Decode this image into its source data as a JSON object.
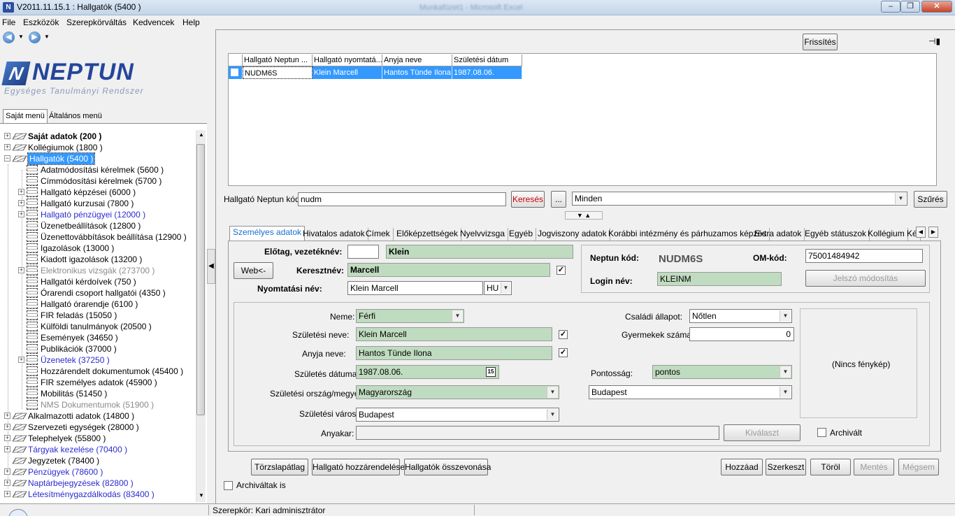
{
  "window": {
    "title": "V2011.11.15.1 : Hallgatók (5400  )",
    "background_title": "Munkafüzet1 - Microsoft Excel",
    "app_icon": "N",
    "minimize": "–",
    "restore": "❐",
    "close": "✕"
  },
  "menu": [
    "File",
    "Eszközök",
    "Szerepkörváltás",
    "Kedvencek",
    "Help"
  ],
  "nav": {
    "back": "◀",
    "forward": "▶",
    "drop": "▼"
  },
  "logo": {
    "mark": "N",
    "text": "NEPTUN",
    "subtitle": "Egységes Tanulmányi Rendszer"
  },
  "sidebar_tabs": {
    "own": "Saját menü",
    "general": "Általános menü"
  },
  "tree": [
    {
      "label": "Saját adatok (200  )",
      "level": 0,
      "expander": "+",
      "icon": "book",
      "style": "bold"
    },
    {
      "label": "Kollégiumok (1800  )",
      "level": 0,
      "expander": "+",
      "icon": "book",
      "style": ""
    },
    {
      "label": "Hallgatók (5400  )",
      "level": 0,
      "expander": "−",
      "icon": "book",
      "style": "sel"
    },
    {
      "label": "Adatmódosítási kérelmek (5600  )",
      "level": 1,
      "expander": "",
      "icon": "doc",
      "style": ""
    },
    {
      "label": "Címmódosítási kérelmek (5700  )",
      "level": 1,
      "expander": "",
      "icon": "doc",
      "style": ""
    },
    {
      "label": "Hallgató képzései (6000  )",
      "level": 1,
      "expander": "+",
      "icon": "doc",
      "style": ""
    },
    {
      "label": "Hallgató kurzusai (7800  )",
      "level": 1,
      "expander": "+",
      "icon": "doc",
      "style": ""
    },
    {
      "label": "Hallgató pénzügyei (12000  )",
      "level": 1,
      "expander": "+",
      "icon": "doc",
      "style": "blue"
    },
    {
      "label": "Üzenetbeállítások (12800  )",
      "level": 1,
      "expander": "",
      "icon": "doc",
      "style": ""
    },
    {
      "label": "Üzenettovábbítások beállítása (12900  )",
      "level": 1,
      "expander": "",
      "icon": "doc",
      "style": ""
    },
    {
      "label": "Igazolások (13000  )",
      "level": 1,
      "expander": "",
      "icon": "doc",
      "style": ""
    },
    {
      "label": "Kiadott igazolások (13200  )",
      "level": 1,
      "expander": "",
      "icon": "doc",
      "style": ""
    },
    {
      "label": "Elektronikus vizsgák (273700  )",
      "level": 1,
      "expander": "+",
      "icon": "doc",
      "style": "gray"
    },
    {
      "label": "Hallgatói kérdoívek (750  )",
      "level": 1,
      "expander": "",
      "icon": "doc",
      "style": ""
    },
    {
      "label": "Órarendi csoport hallgatói (4350  )",
      "level": 1,
      "expander": "",
      "icon": "doc",
      "style": ""
    },
    {
      "label": "Hallgató órarendje (6100  )",
      "level": 1,
      "expander": "",
      "icon": "doc",
      "style": ""
    },
    {
      "label": "FIR feladás (15050  )",
      "level": 1,
      "expander": "",
      "icon": "doc",
      "style": ""
    },
    {
      "label": "Külföldi tanulmányok (20500  )",
      "level": 1,
      "expander": "",
      "icon": "doc",
      "style": ""
    },
    {
      "label": "Események (34650  )",
      "level": 1,
      "expander": "",
      "icon": "doc",
      "style": ""
    },
    {
      "label": "Publikációk (37000  )",
      "level": 1,
      "expander": "",
      "icon": "doc",
      "style": ""
    },
    {
      "label": "Üzenetek (37250  )",
      "level": 1,
      "expander": "+",
      "icon": "doc",
      "style": "blue"
    },
    {
      "label": "Hozzárendelt dokumentumok (45400  )",
      "level": 1,
      "expander": "",
      "icon": "doc",
      "style": ""
    },
    {
      "label": "FIR személyes adatok (45900  )",
      "level": 1,
      "expander": "",
      "icon": "doc",
      "style": ""
    },
    {
      "label": "Mobilitás (51450  )",
      "level": 1,
      "expander": "",
      "icon": "doc",
      "style": ""
    },
    {
      "label": "NMS Dokumentumok (51900  )",
      "level": 1,
      "expander": "",
      "icon": "doc",
      "style": "gray"
    },
    {
      "label": "Alkalmazotti adatok (14800  )",
      "level": 0,
      "expander": "+",
      "icon": "book",
      "style": ""
    },
    {
      "label": "Szervezeti egységek (28000  )",
      "level": 0,
      "expander": "+",
      "icon": "book",
      "style": ""
    },
    {
      "label": "Telephelyek (55800  )",
      "level": 0,
      "expander": "+",
      "icon": "book",
      "style": ""
    },
    {
      "label": "Tárgyak kezelése (70400  )",
      "level": 0,
      "expander": "+",
      "icon": "book",
      "style": "blue"
    },
    {
      "label": "Jegyzetek (78400  )",
      "level": 0,
      "expander": "",
      "icon": "book",
      "style": ""
    },
    {
      "label": "Pénzügyek (78600  )",
      "level": 0,
      "expander": "+",
      "icon": "book",
      "style": "blue"
    },
    {
      "label": "Naptárbejegyzések (82800  )",
      "level": 0,
      "expander": "+",
      "icon": "book",
      "style": "blue"
    },
    {
      "label": "Létesítménygazdálkodás (83400  )",
      "level": 0,
      "expander": "+",
      "icon": "book",
      "style": "blue"
    }
  ],
  "toolbar": {
    "refresh": "Frissítés",
    "pin_icon": "📌"
  },
  "grid": {
    "headers": [
      "Hallgató Neptun ...",
      "Hallgató nyomtatá...",
      "Anyja neve",
      "Születési dátum"
    ],
    "rows": [
      [
        "NUDM6S",
        "Klein Marcell",
        "Hantos Tünde Ilona",
        "1987.08.06."
      ]
    ]
  },
  "search": {
    "label": "Hallgató Neptun kódja",
    "value": "nudm",
    "search_btn": "Keresés",
    "more_btn": "...",
    "filter_value": "Minden",
    "filter_btn": "Szűrés"
  },
  "splitter": "▼ ▲",
  "tabs": [
    "Személyes adatok",
    "Hivatalos adatok",
    "Címek",
    "Előképzettségek",
    "Nyelvvizsga",
    "Egyéb",
    "Jogviszony adatok",
    "Korábbi intézmény és párhuzamos képzés",
    "Extra adatok",
    "Egyéb státuszok",
    "Kollégium",
    "Ké"
  ],
  "tab_scroll": {
    "left": "◀",
    "right": "▶"
  },
  "person": {
    "prefix_label": "Előtag, vezetéknév:",
    "prefix": "",
    "surname": "Klein",
    "web_btn": "Web<-",
    "firstname_label": "Keresztnév:",
    "firstname": "Marcell",
    "firstname_checked": "✓",
    "printname_label": "Nyomtatási név:",
    "printname": "Klein Marcell",
    "lang": "HU",
    "neptun_label": "Neptun kód:",
    "neptun": "NUDM6S",
    "om_label": "OM-kód:",
    "om": "75001484942",
    "login_label": "Login név:",
    "login": "KLEINM",
    "pw_btn": "Jelszó módosítás"
  },
  "details": {
    "gender_label": "Neme:",
    "gender": "Férfi",
    "birthname_label": "Születési neve:",
    "birthname": "Klein Marcell",
    "mother_label": "Anyja neve:",
    "mother": "Hantos Tünde Ilona",
    "birthdate_label": "Születés dátuma:",
    "birthdate": "1987.08.06.",
    "calendar": "15",
    "birthcountry_label": "Születési ország/megye:",
    "birthcountry": "Magyarország",
    "county": "Budapest",
    "birthcity_label": "Születési város:",
    "birthcity": "Budapest",
    "anyakar_label": "Anyakar:",
    "anyakar": "",
    "select_btn": "Kiválaszt",
    "marital_label": "Családi állapot:",
    "marital": "Nőtlen",
    "children_label": "Gyermekek száma:",
    "children": "0",
    "accuracy_label": "Pontosság:",
    "accuracy": "pontos",
    "photo": "(Nincs fénykép)",
    "archived_label": "Archivált",
    "check": "✓"
  },
  "actions": {
    "torzslap": "Törzslapátlag",
    "assign": "Hallgató hozzárendelése",
    "merge": "Hallgatók összevonása",
    "add": "Hozzáad",
    "edit": "Szerkeszt",
    "delete": "Töröl",
    "save": "Mentés",
    "cancel": "Mégsem",
    "archived_too": "Archiváltak is"
  },
  "status": {
    "role": "Szerepkör: Kari adminisztrátor"
  }
}
